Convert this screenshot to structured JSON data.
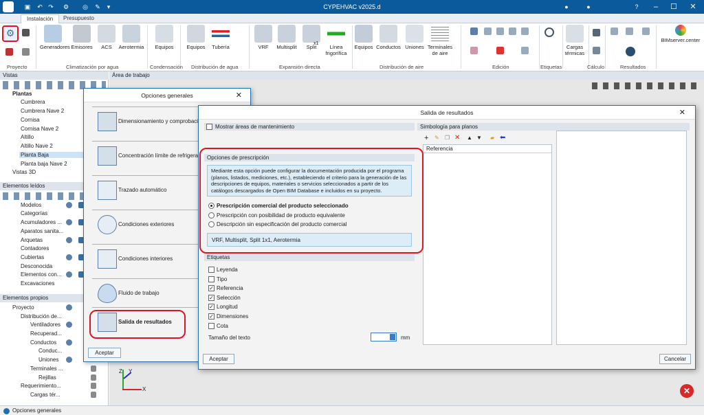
{
  "app": {
    "title": "CYPEHVAC v2025.d"
  },
  "tabs": [
    "Instalación",
    "Presupuesto"
  ],
  "ribbon": {
    "buttons": [
      "Generadores",
      "Emisores",
      "ACS",
      "Aerotermia",
      "Equipos",
      "Equipos",
      "Tubería",
      "VRF",
      "Multisplit",
      "Split",
      "Línea frigorífica",
      "Equipos",
      "Conductos",
      "Uniones",
      "Terminales de aire",
      "Cargas térmicas",
      "BIMserver.center"
    ],
    "split_x1": "x1",
    "groups": [
      "Proyecto",
      "Climatización por agua",
      "Condensación",
      "Distribución de agua",
      "Expansión directa",
      "Distribución de aire",
      "Edición",
      "Etiquetas",
      "Cálculo",
      "Resultados"
    ]
  },
  "left": {
    "vistas_header": "Vistas",
    "workarea_header": "Área de trabajo",
    "plantas_label": "Plantas",
    "plantas": [
      "Cumbrera",
      "Cumbrera Nave 2",
      "Cornisa",
      "Cornisa Nave 2",
      "Altillo",
      "Altillo Nave 2",
      "Planta Baja",
      "Planta baja Nave 2"
    ],
    "vistas3d": "Vistas 3D",
    "leidos_header": "Elementos leídos",
    "modelos": "Modelos",
    "categorias": "Categorías",
    "cat_items": [
      "Acumuladores ...",
      "Aparatos sanita...",
      "Arquetas",
      "Contadores",
      "Cubiertas",
      "Desconocida",
      "Elementos con...",
      "Excavaciones"
    ],
    "propios_header": "Elementos propios",
    "proyecto": "Proyecto",
    "propios_items": [
      "Distribución de...",
      "Ventiladores",
      "Recuperad...",
      "Conductos",
      "Conduc...",
      "Uniones",
      "Terminales ...",
      "Rejillas",
      "Requerimiento...",
      "Cargas tér..."
    ]
  },
  "status": "Opciones generales",
  "axis": {
    "x": "X",
    "y": "Y",
    "z": "Z"
  },
  "dialog_general": {
    "title": "Opciones generales",
    "options": [
      "Dimensionamiento y comprobación",
      "Concentración límite de refrigerante",
      "Trazado automático",
      "Condiciones exteriores",
      "Condiciones interiores",
      "Fluido de trabajo",
      "Salida de resultados"
    ],
    "accept": "Aceptar"
  },
  "dialog_results": {
    "title": "Salida de resultados",
    "mostrar": "Mostrar áreas de mantenimiento",
    "simbologia": "Simbología para planos",
    "referencia_col": "Referencia",
    "prescripcion_header": "Opciones de prescripción",
    "info": "Mediante esta opción puede configurar la documentación producida por el programa (planos, listados, mediciones, etc.), estableciendo el criterio para la generación de las descripciones de equipos, materiales o servicios seleccionados a partir de los catálogos descargados de Open BIM Database e incluidos en su proyecto.",
    "radios": [
      "Prescripción comercial del producto seleccionado",
      "Prescripción con posibilidad de producto equivalente",
      "Descripción sin especificación del producto comercial"
    ],
    "products": "VRF, Multisplit, Split 1x1, Aerotermia",
    "etiquetas_header": "Etiquetas",
    "etiquetas": [
      {
        "label": "Leyenda",
        "checked": false
      },
      {
        "label": "Tipo",
        "checked": false
      },
      {
        "label": "Referencia",
        "checked": true
      },
      {
        "label": "Selección",
        "checked": true
      },
      {
        "label": "Longitud",
        "checked": true
      },
      {
        "label": "Dimensiones",
        "checked": true
      },
      {
        "label": "Cota",
        "checked": false
      }
    ],
    "text_size_label": "Tamaño del texto",
    "text_size_value": "",
    "unit": "mm",
    "accept": "Aceptar",
    "cancel": "Cancelar"
  },
  "colors": {
    "accent": "#0a5a9c",
    "highlight": "#e0141e",
    "info_bg": "#dcedf8"
  }
}
